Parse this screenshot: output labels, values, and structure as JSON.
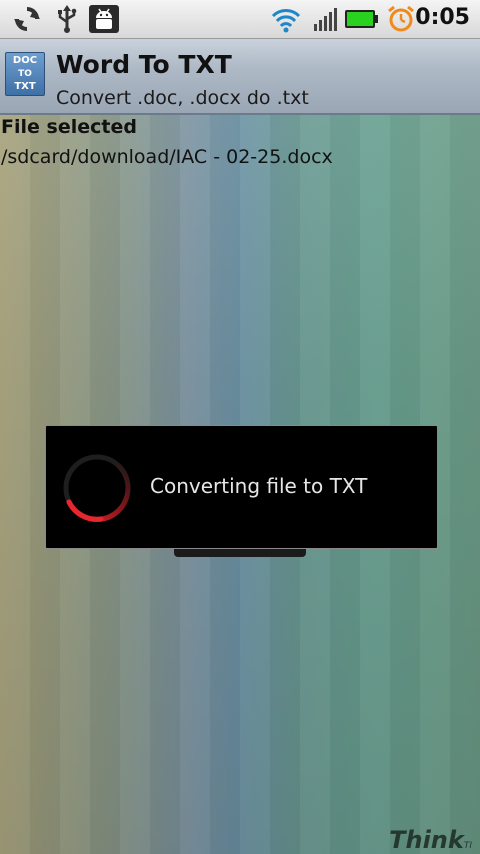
{
  "status_bar": {
    "time": "0:05",
    "icons": [
      "sync-icon",
      "usb-icon",
      "android-debug-icon",
      "wifi-icon",
      "signal-icon",
      "battery-icon",
      "alarm-icon"
    ]
  },
  "app": {
    "title": "Word To TXT",
    "subtitle": "Convert .doc, .docx do .txt",
    "icon_lines": [
      "DOC",
      "TO",
      "TXT"
    ]
  },
  "content": {
    "label": "File selected",
    "path": "/sdcard/download/IAC - 02-25.docx"
  },
  "dialog": {
    "message": "Converting file to TXT"
  },
  "watermark": {
    "text": "Think",
    "suffix": "TI"
  },
  "colors": {
    "battery": "#2bd11f",
    "alarm": "#f08a1c",
    "wifi": "#1f86c8",
    "spinner": "#d6232b"
  }
}
